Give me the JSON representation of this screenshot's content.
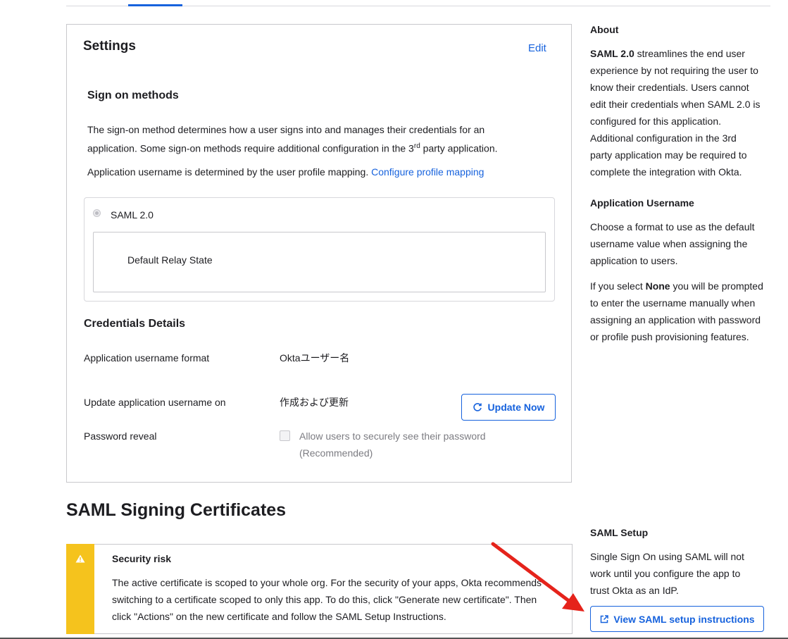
{
  "settings": {
    "title": "Settings",
    "edit_label": "Edit",
    "sign_on": {
      "heading": "Sign on methods",
      "desc_part1": "The sign-on method determines how a user signs into and manages their credentials for an",
      "desc_part2": "application. Some sign-on methods require additional configuration in the 3",
      "desc_sup": "rd",
      "desc_part3": " party application.",
      "username_text": "Application username is determined by the user profile mapping.",
      "configure_link": "Configure profile mapping",
      "saml_option": "SAML 2.0",
      "relay_state_label": "Default Relay State"
    },
    "credentials": {
      "heading": "Credentials Details",
      "username_format_label": "Application username format",
      "username_format_value": "Oktaユーザー名",
      "update_on_label": "Update application username on",
      "update_on_value": "作成および更新",
      "update_now_button": "Update Now",
      "password_reveal_label": "Password reveal",
      "allow_reveal_line1": "Allow users to securely see their password",
      "allow_reveal_line2": "(Recommended)"
    }
  },
  "certificates": {
    "heading": "SAML Signing Certificates",
    "alert": {
      "title": "Security risk",
      "line1": "The active certificate is scoped to your whole org. For the security of your apps, Okta recommends",
      "line2": "switching to a certificate scoped to only this app. To do this, click \"Generate new certificate\". Then",
      "line3": "click \"Actions\" on the new certificate and follow the SAML Setup Instructions."
    }
  },
  "sidebar": {
    "about": {
      "heading": "About",
      "lead": "SAML 2.0",
      "lines": [
        "streamlines the end user",
        "experience by not requiring the user to",
        "know their credentials. Users cannot",
        "edit their credentials when SAML 2.0 is",
        "configured for this application.",
        "Additional configuration in the 3rd",
        "party application may be required to",
        "complete the integration with Okta."
      ]
    },
    "app_username": {
      "heading": "Application Username",
      "lines": [
        "Choose a format to use as the default",
        "username value when assigning the",
        "application to users."
      ],
      "none_prefix": "If you select",
      "none_word": "None",
      "none_rest": "you will be prompted",
      "none_lines": [
        "to enter the username manually when",
        "assigning an application with password",
        "or profile push provisioning features."
      ]
    },
    "saml_setup": {
      "heading": "SAML Setup",
      "lines": [
        "Single Sign On using SAML will not",
        "work until you configure the app to",
        "trust Okta as an IdP."
      ],
      "button_label": "View SAML setup instructions"
    }
  },
  "colors": {
    "accent": "#1662dd",
    "warning": "#f5c31d",
    "annotation_arrow": "#e5231b"
  },
  "icons": {
    "refresh": "refresh-icon",
    "warning": "warning-icon",
    "external_link": "external-link-icon"
  }
}
